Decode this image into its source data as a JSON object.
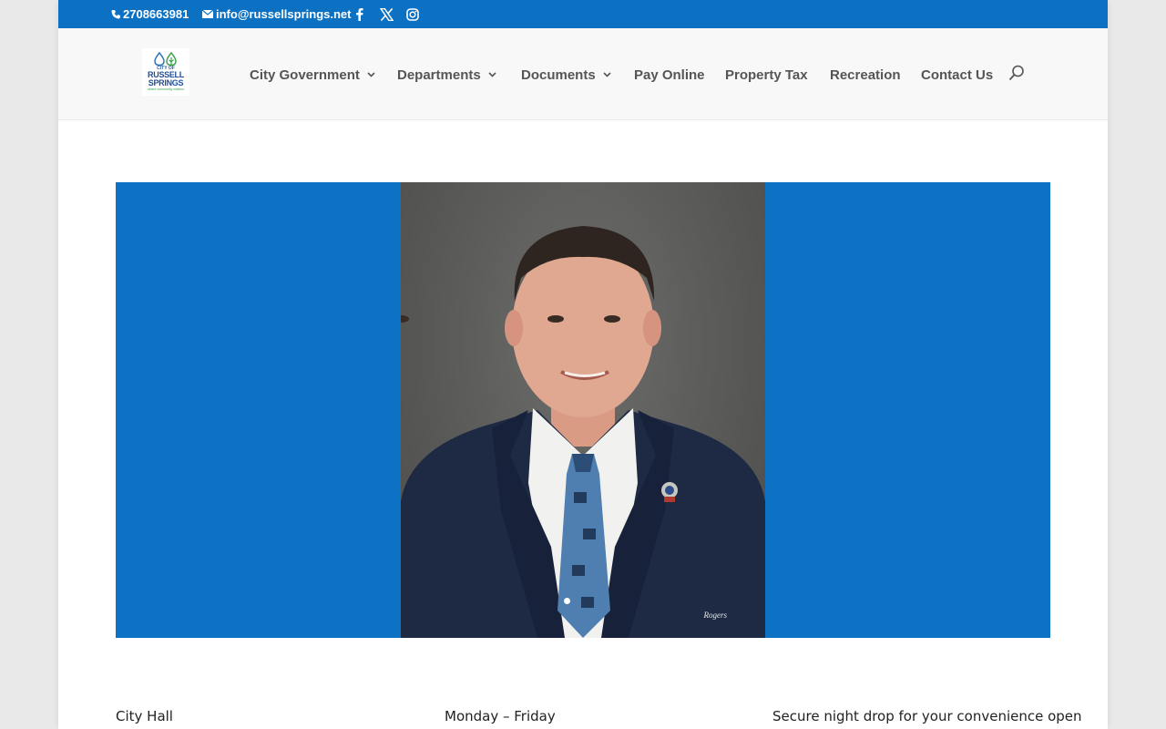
{
  "topbar": {
    "phone": "2708663981",
    "email": "info@russellsprings.net",
    "social": [
      "facebook-icon",
      "x-icon",
      "instagram-icon"
    ],
    "bg_color": "#0c71c3"
  },
  "logo": {
    "line1": "CITY OF",
    "line2": "RUSSELL",
    "line3": "SPRINGS",
    "tagline": "where community matters"
  },
  "nav": {
    "items": [
      {
        "label": "City Government",
        "has_dropdown": true
      },
      {
        "label": "Departments",
        "has_dropdown": true
      },
      {
        "label": "Documents",
        "has_dropdown": true
      },
      {
        "label": "Pay Online",
        "has_dropdown": false
      },
      {
        "label": "Property Tax",
        "has_dropdown": false
      },
      {
        "label": "Recreation",
        "has_dropdown": false
      },
      {
        "label": "Contact Us",
        "has_dropdown": false
      }
    ],
    "search_icon": "search-icon"
  },
  "hero": {
    "bg_color": "#0d71c4",
    "photo_caption": "Rogers",
    "active_slide": 1
  },
  "info": {
    "col1": "City Hall",
    "col2": "Monday – Friday",
    "col3": "Secure night drop for your convenience open"
  }
}
